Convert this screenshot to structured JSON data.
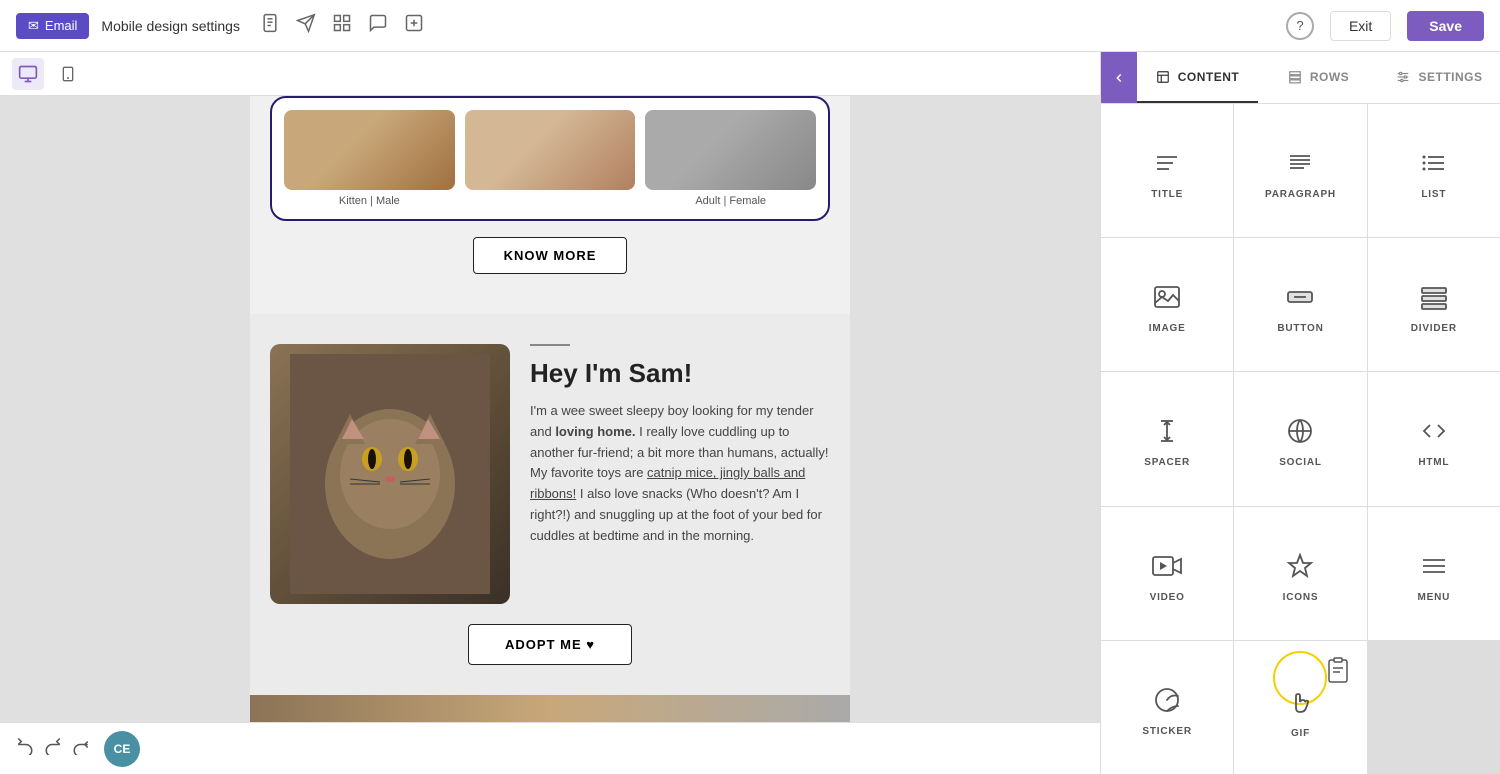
{
  "topbar": {
    "email_label": "Email",
    "title": "Mobile design settings",
    "help_label": "?",
    "exit_label": "Exit",
    "save_label": "Save"
  },
  "device": {
    "desktop_label": "Desktop view",
    "mobile_label": "Mobile view"
  },
  "canvas": {
    "pet_label_1": "Kitten | Male",
    "pet_label_2": "",
    "pet_label_3": "Adult | Female",
    "know_more_label": "KNOW MORE",
    "sam_heading": "Hey I'm Sam!",
    "sam_divider": "",
    "sam_body_1": "I'm a wee sweet sleepy boy looking for my tender and ",
    "sam_body_bold": "loving home.",
    "sam_body_2": " I really love cuddling up to another fur-friend; a bit more than humans, actually! My favorite toys are ",
    "sam_body_link": "catnip mice, jingly balls and ribbons!",
    "sam_body_3": " I also love snacks (Who doesn't? Am I right?!) and snuggling up at the foot of your bed for cuddles at bedtime and in the morning.",
    "adopt_btn": "ADOPT ME ♥"
  },
  "panel": {
    "arrow_label": "collapse",
    "tab_content": "CONTENT",
    "tab_rows": "ROWS",
    "tab_settings": "SETTINGS",
    "items": [
      {
        "id": "title",
        "label": "TITLE",
        "icon": "title"
      },
      {
        "id": "paragraph",
        "label": "PARAGRAPH",
        "icon": "paragraph"
      },
      {
        "id": "list",
        "label": "LIST",
        "icon": "list"
      },
      {
        "id": "image",
        "label": "IMAGE",
        "icon": "image"
      },
      {
        "id": "button",
        "label": "BUTTON",
        "icon": "button"
      },
      {
        "id": "divider",
        "label": "DIVIDER",
        "icon": "divider"
      },
      {
        "id": "spacer",
        "label": "SPACER",
        "icon": "spacer"
      },
      {
        "id": "social",
        "label": "SOCIAL",
        "icon": "social"
      },
      {
        "id": "html",
        "label": "HTML",
        "icon": "html"
      },
      {
        "id": "video",
        "label": "VIDEO",
        "icon": "video"
      },
      {
        "id": "icons",
        "label": "ICONS",
        "icon": "icons"
      },
      {
        "id": "menu",
        "label": "MENU",
        "icon": "menu"
      },
      {
        "id": "sticker",
        "label": "STICKER",
        "icon": "sticker"
      },
      {
        "id": "gif",
        "label": "GIF",
        "icon": "gif"
      }
    ]
  },
  "bottombar": {
    "undo_label": "Undo",
    "redo_label": "Redo",
    "forward_label": "Forward",
    "avatar_label": "CE"
  }
}
